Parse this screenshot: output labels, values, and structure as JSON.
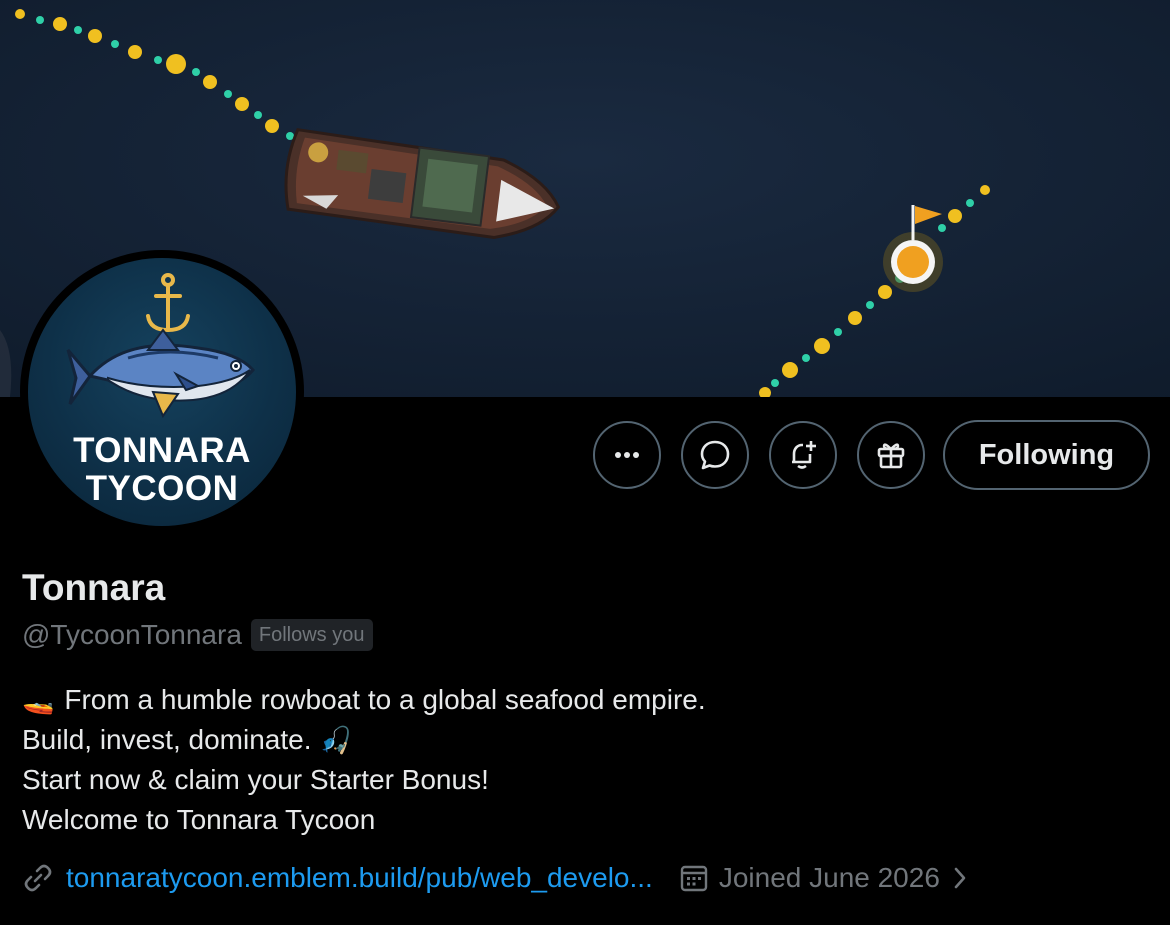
{
  "banner": {
    "alt_icons": [
      "fishing-boat",
      "route-dots",
      "flag-marker"
    ]
  },
  "avatar": {
    "logo_line1": "TONNARA",
    "logo_line2": "TYCOON"
  },
  "actions": {
    "more_icon": "more-horizontal-icon",
    "message_icon": "message-bubble-icon",
    "notify_icon": "bell-plus-icon",
    "gift_icon": "gift-icon",
    "follow_label": "Following"
  },
  "profile": {
    "display_name": "Tonnara",
    "handle": "@TycoonTonnara",
    "follows_you": "Follows you",
    "bio": [
      {
        "emoji": "🚤",
        "text": "From a humble rowboat to a global seafood empire."
      },
      {
        "emoji": "",
        "text": "Build, invest, dominate.",
        "suffix_emoji": "🎣"
      },
      {
        "emoji": "",
        "text": "Start now & claim your Starter Bonus!"
      },
      {
        "emoji": "",
        "text": "Welcome to Tonnara Tycoon"
      }
    ],
    "link": "tonnaratycoon.emblem.build/pub/web_develo...",
    "joined": "Joined June 2026"
  },
  "colors": {
    "accent": "#1d9bf0",
    "muted": "#71767b",
    "border": "#536471",
    "sea": "#122033",
    "route_yellow": "#f0c020",
    "route_teal": "#2fd0a8"
  }
}
